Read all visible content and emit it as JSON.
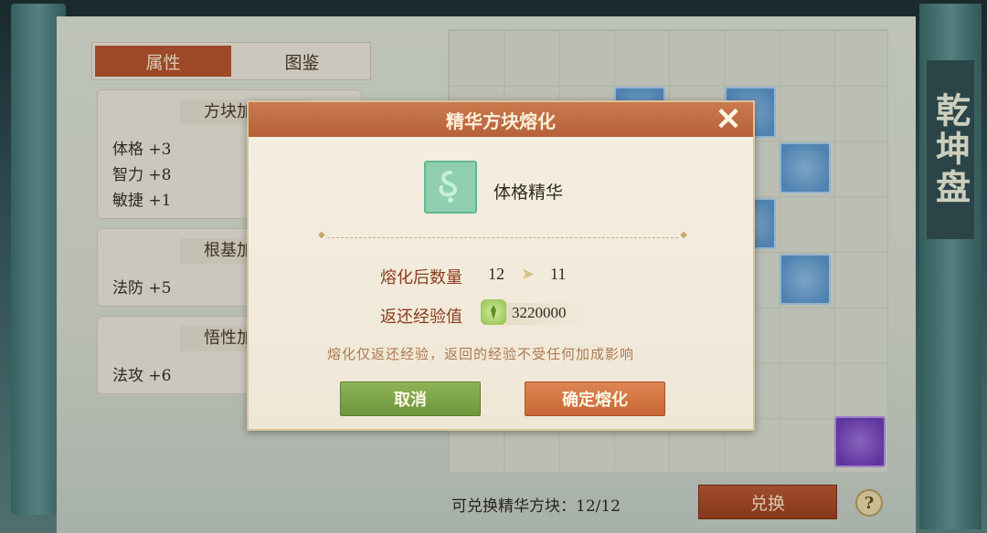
{
  "panel_title": "乾坤盘",
  "tabs": [
    {
      "label": "属性",
      "active": true
    },
    {
      "label": "图鉴",
      "active": false
    }
  ],
  "attribute_groups": [
    {
      "title": "方块加",
      "lines": [
        "体格 +3",
        "智力 +8",
        "敏捷 +1"
      ]
    },
    {
      "title": "根基加",
      "lines": [
        "法防 +5"
      ]
    },
    {
      "title": "悟性加",
      "lines": [
        "法攻 +6"
      ]
    }
  ],
  "bottom_bar": {
    "exchange_info": "可兑换精华方块：12/12",
    "exchange_button": "兑换",
    "help_button": "?"
  },
  "dialog": {
    "title": "精华方块熔化",
    "close_label": "✕",
    "item_name": "体格精华",
    "count_label": "熔化后数量",
    "count_before": "12",
    "count_after": "11",
    "exp_label": "返还经验值",
    "exp_value": "3220000",
    "note": "熔化仅返还经验，返回的经验不受任何加成影响",
    "cancel_button": "取消",
    "confirm_button": "确定熔化"
  },
  "colors": {
    "accent": "#b3532c",
    "confirm": "#c86735",
    "cancel": "#6f963c"
  }
}
